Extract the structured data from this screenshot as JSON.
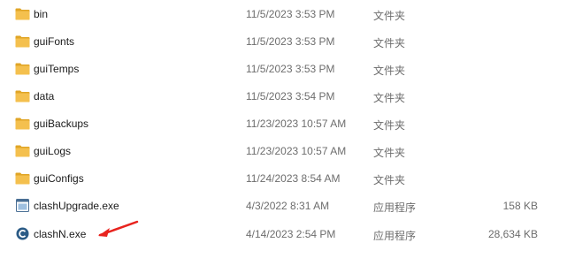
{
  "files": [
    {
      "name": "bin",
      "date": "11/5/2023 3:53 PM",
      "type": "文件夹",
      "size": "",
      "icon": "folder-icon"
    },
    {
      "name": "guiFonts",
      "date": "11/5/2023 3:53 PM",
      "type": "文件夹",
      "size": "",
      "icon": "folder-icon"
    },
    {
      "name": "guiTemps",
      "date": "11/5/2023 3:53 PM",
      "type": "文件夹",
      "size": "",
      "icon": "folder-icon"
    },
    {
      "name": "data",
      "date": "11/5/2023 3:54 PM",
      "type": "文件夹",
      "size": "",
      "icon": "folder-icon"
    },
    {
      "name": "guiBackups",
      "date": "11/23/2023 10:57 AM",
      "type": "文件夹",
      "size": "",
      "icon": "folder-icon"
    },
    {
      "name": "guiLogs",
      "date": "11/23/2023 10:57 AM",
      "type": "文件夹",
      "size": "",
      "icon": "folder-icon"
    },
    {
      "name": "guiConfigs",
      "date": "11/24/2023 8:54 AM",
      "type": "文件夹",
      "size": "",
      "icon": "folder-icon"
    },
    {
      "name": "clashUpgrade.exe",
      "date": "4/3/2022 8:31 AM",
      "type": "应用程序",
      "size": "158 KB",
      "icon": "application-icon"
    },
    {
      "name": "clashN.exe",
      "date": "4/14/2023 2:54 PM",
      "type": "应用程序",
      "size": "28,634 KB",
      "icon": "clashn-app-icon"
    }
  ],
  "colors": {
    "folder": "#f4c04e",
    "folder_dark": "#e0a526",
    "annotation_arrow": "#e8231e",
    "clashn_icon": "#2b5b86"
  }
}
